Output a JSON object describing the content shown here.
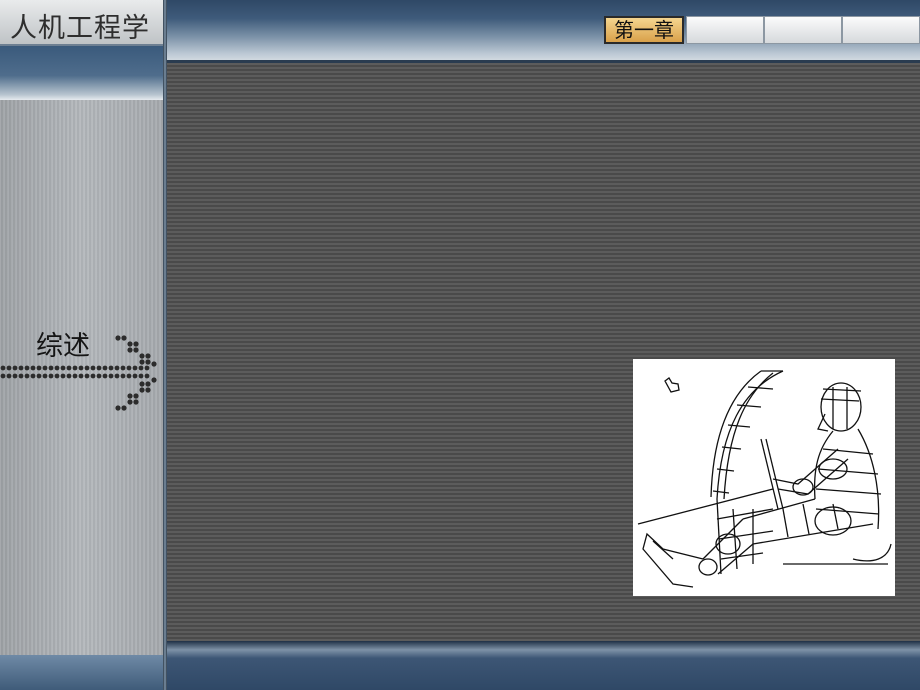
{
  "app": {
    "title": "人机工程学"
  },
  "tabs": [
    {
      "label": "第一章",
      "active": true
    },
    {
      "label": "",
      "active": false
    },
    {
      "label": "",
      "active": false
    },
    {
      "label": "",
      "active": false
    }
  ],
  "sidebar": {
    "section_label": "综述"
  },
  "figure": {
    "icon": "seated-driver-wireframe-drawing"
  },
  "colors": {
    "tab_active": "#e4b260",
    "main_bg": "#555555",
    "header": "#3f5b7b"
  }
}
